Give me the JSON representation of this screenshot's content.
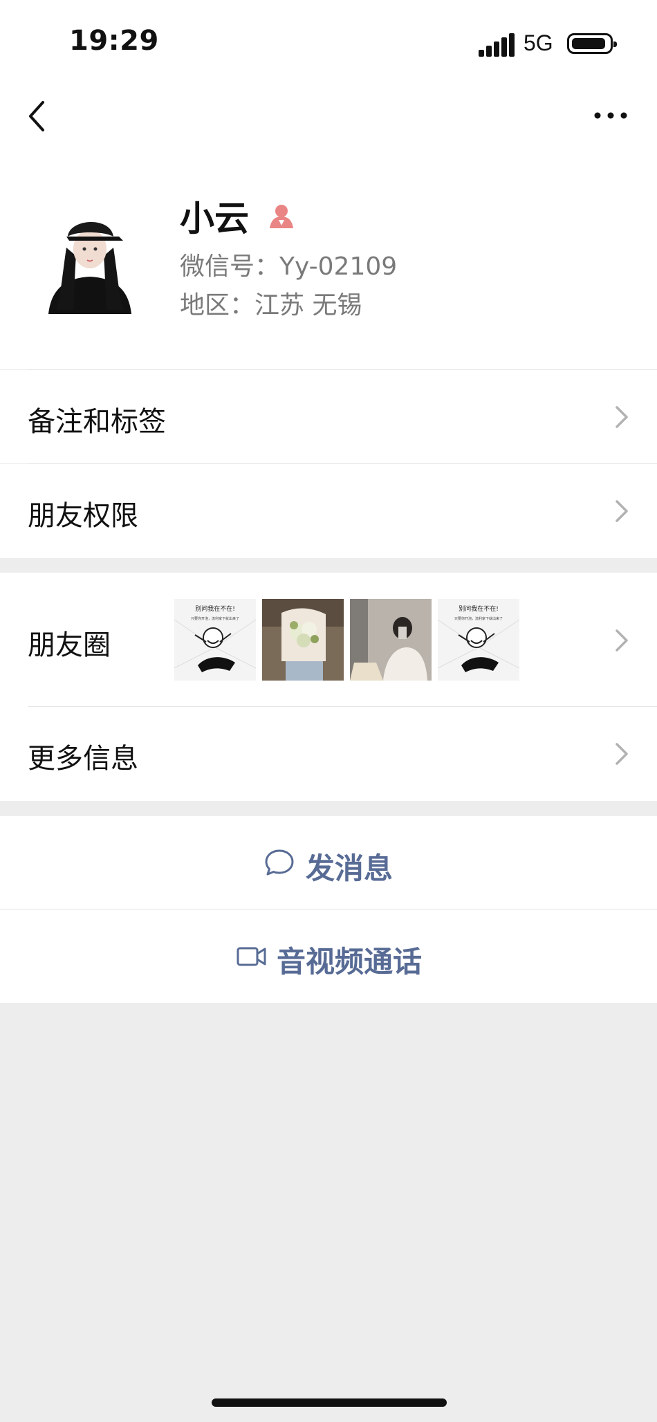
{
  "status_bar": {
    "time": "19:29",
    "network": "5G"
  },
  "profile": {
    "name": "小云",
    "wechat_id": "微信号：Yy-02109",
    "region": "地区：江苏 无锡",
    "gender_icon": "female-icon"
  },
  "menu": {
    "remark_tags": "备注和标签",
    "friend_permissions": "朋友权限",
    "moments": "朋友圈",
    "more_info": "更多信息"
  },
  "moments_thumbs": {
    "meme_title": "别问我在不在!",
    "meme_sub": "只要你开泡，流利家下就出来了"
  },
  "actions": {
    "send_message": "发消息",
    "video_call": "音视频通话"
  },
  "colors": {
    "link": "#576b95",
    "background": "#ededed",
    "gender_female": "#e98584"
  }
}
